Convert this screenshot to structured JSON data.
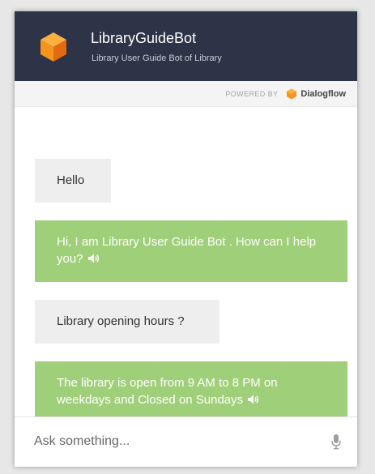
{
  "header": {
    "title": "LibraryGuideBot",
    "subtitle": "Library User Guide Bot of Library"
  },
  "powered": {
    "label": "POWERED BY",
    "brand": "Dialogflow"
  },
  "messages": [
    {
      "from": "user",
      "text": "Hello"
    },
    {
      "from": "bot",
      "text": "Hi, I am Library User Guide Bot . How can I help you?"
    },
    {
      "from": "user",
      "text": "Library opening hours ?"
    },
    {
      "from": "bot",
      "text": "The library is open from 9 AM to 8 PM on weekdays and Closed on Sundays"
    }
  ],
  "input": {
    "placeholder": "Ask something..."
  },
  "colors": {
    "header_bg": "#2e3447",
    "bot_bubble": "#a0cf79",
    "user_bubble": "#eeeeee",
    "logo_orange": "#f7941d"
  },
  "icons": {
    "logo": "cube-icon",
    "speaker": "speaker-icon",
    "mic": "microphone-icon"
  }
}
